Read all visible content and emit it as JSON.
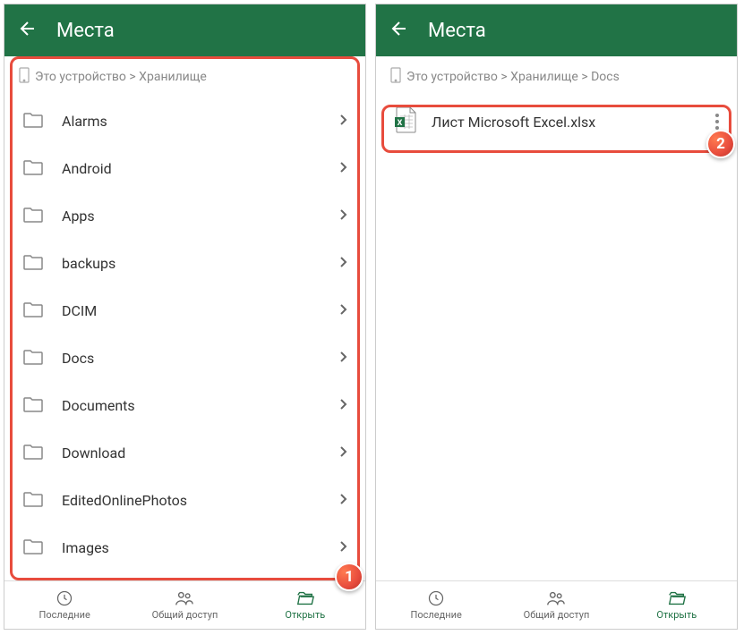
{
  "header": {
    "title": "Места"
  },
  "left": {
    "breadcrumb": "Это устройство > Хранилище",
    "folders": [
      {
        "name": "Alarms"
      },
      {
        "name": "Android"
      },
      {
        "name": "Apps"
      },
      {
        "name": "backups"
      },
      {
        "name": "DCIM"
      },
      {
        "name": "Docs"
      },
      {
        "name": "Documents"
      },
      {
        "name": "Download"
      },
      {
        "name": "EditedOnlinePhotos"
      },
      {
        "name": "Images"
      }
    ],
    "badge": "1"
  },
  "right": {
    "breadcrumb": "Это устройство > Хранилище > Docs",
    "file_name": "Лист Microsoft Excel.xlsx",
    "badge": "2"
  },
  "nav": {
    "recent": "Последние",
    "shared": "Общий доступ",
    "open": "Открыть"
  }
}
